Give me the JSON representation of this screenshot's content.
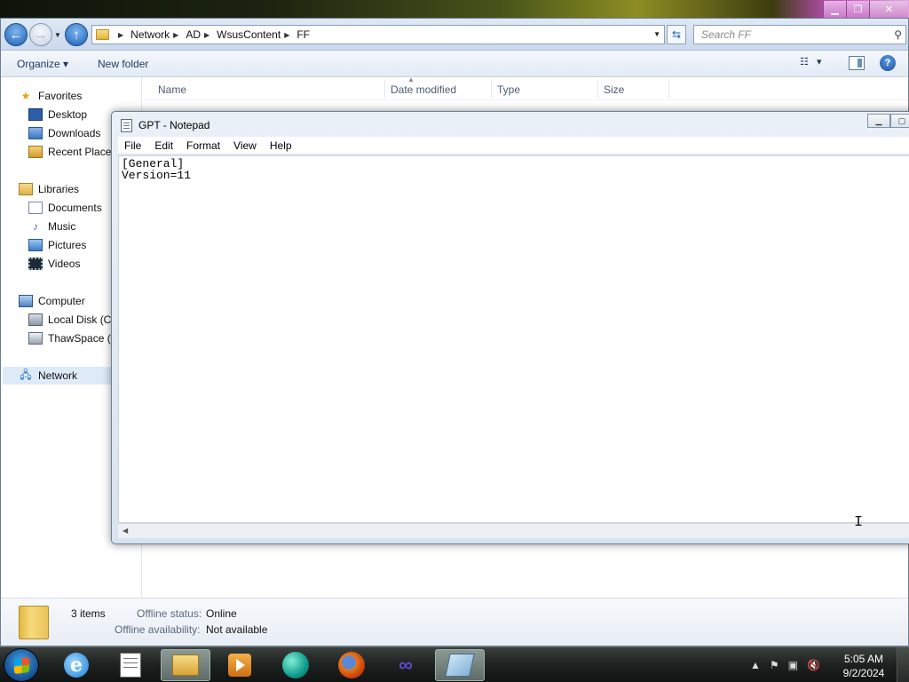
{
  "explorer": {
    "path": [
      "Network",
      "AD",
      "WsusContent",
      "FF"
    ],
    "search_placeholder": "Search FF",
    "toolbar": {
      "organize": "Organize",
      "new_folder": "New folder"
    },
    "columns": [
      "Name",
      "Date modified",
      "Type",
      "Size"
    ],
    "nav": {
      "favorites": {
        "label": "Favorites",
        "items": [
          "Desktop",
          "Downloads",
          "Recent Places"
        ]
      },
      "libraries": {
        "label": "Libraries",
        "items": [
          "Documents",
          "Music",
          "Pictures",
          "Videos"
        ]
      },
      "computer": {
        "label": "Computer",
        "items": [
          "Local Disk (C:)",
          "ThawSpace (E:)"
        ]
      },
      "network": {
        "label": "Network"
      }
    },
    "details": {
      "count": "3 items",
      "offline_status_label": "Offline status:",
      "offline_status_value": "Online",
      "offline_availability_label": "Offline availability:",
      "offline_availability_value": "Not available"
    }
  },
  "notepad": {
    "title": "GPT - Notepad",
    "menu": [
      "File",
      "Edit",
      "Format",
      "View",
      "Help"
    ],
    "content": "[General]\nVersion=11"
  },
  "taskbar": {
    "apps": [
      "internet-explorer",
      "notepad",
      "windows-explorer",
      "media-player",
      "globe-app",
      "firefox",
      "visual-studio",
      "notepad-window"
    ],
    "clock": {
      "time": "5:05 AM",
      "date": "9/2/2024"
    }
  },
  "colors": {
    "accent": "#1c5fb8",
    "title_pink": "#c979c7"
  }
}
